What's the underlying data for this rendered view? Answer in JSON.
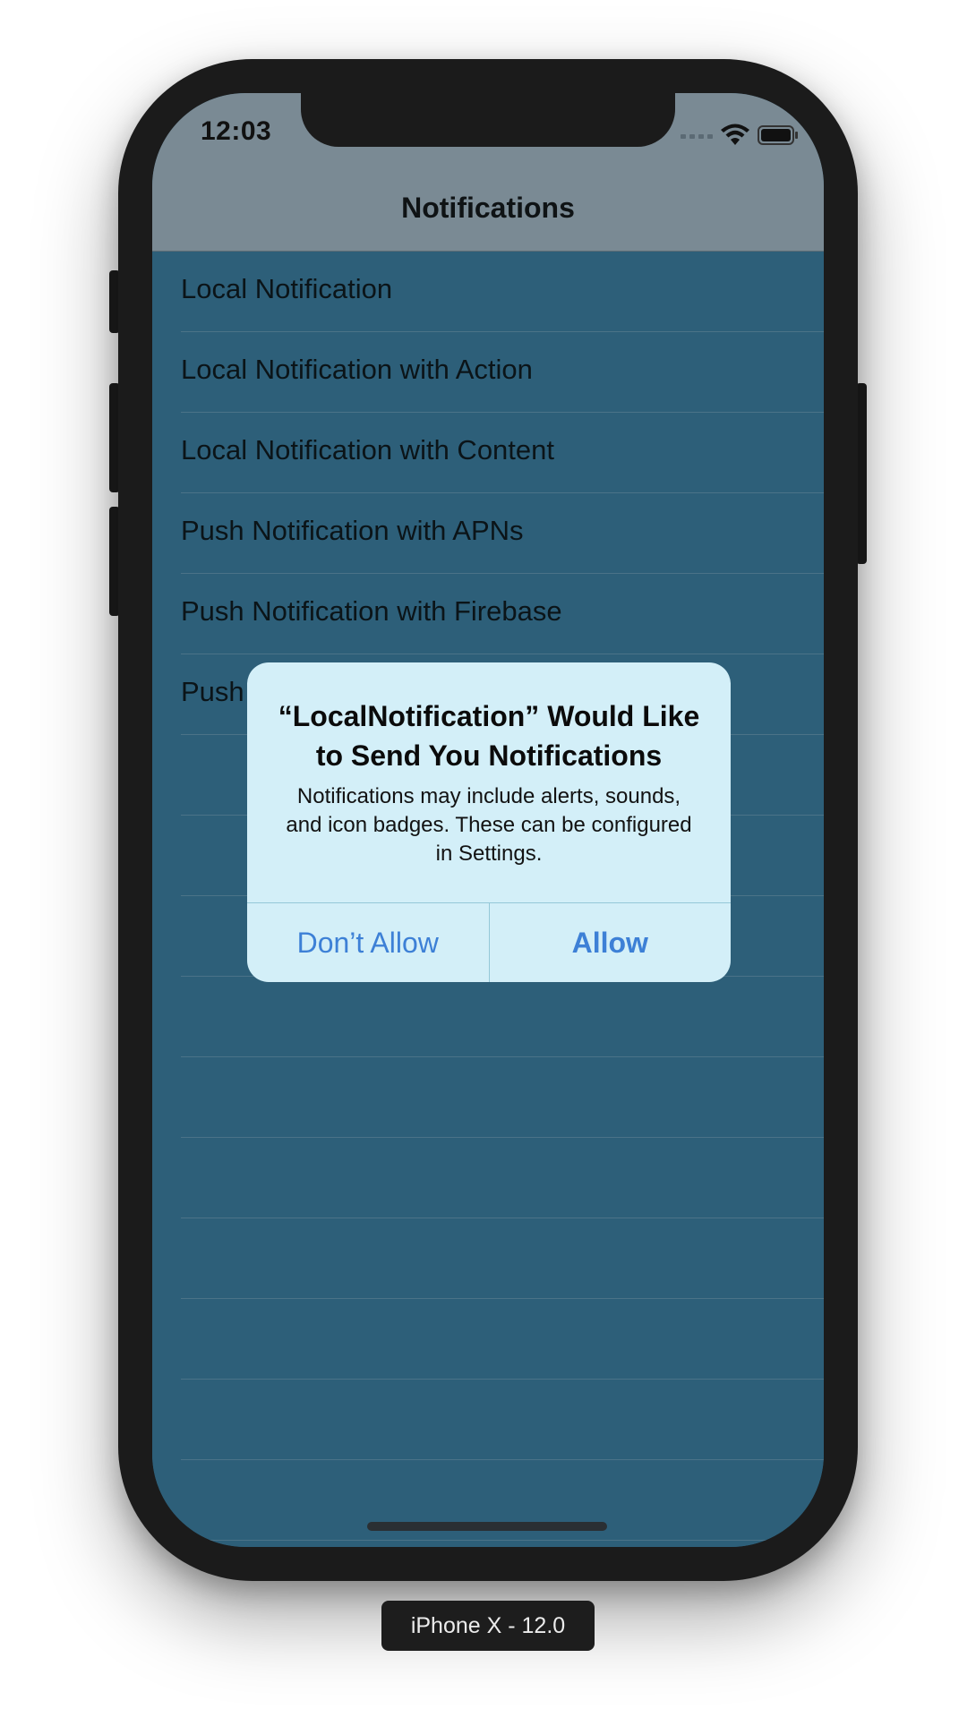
{
  "status_bar": {
    "time": "12:03"
  },
  "nav": {
    "title": "Notifications"
  },
  "table": {
    "rows": [
      "Local Notification",
      "Local Notification with Action",
      "Local Notification with Content",
      "Push Notification with  APNs",
      "Push Notification with Firebase",
      "Push",
      "",
      "",
      "",
      "",
      "",
      "",
      "",
      "",
      "",
      ""
    ]
  },
  "alert": {
    "title": "“LocalNotification” Would Like to Send You Notifications",
    "message": "Notifications may include alerts, sounds, and icon badges. These can be configured in Settings.",
    "dont_allow": "Don’t Allow",
    "allow": "Allow"
  },
  "device_label": "iPhone X - 12.0",
  "colors": {
    "background": "#2d5f79",
    "nav_bar": "#7a8a94",
    "alert_bg": "#d3eff8",
    "alert_button": "#3d80d6"
  }
}
